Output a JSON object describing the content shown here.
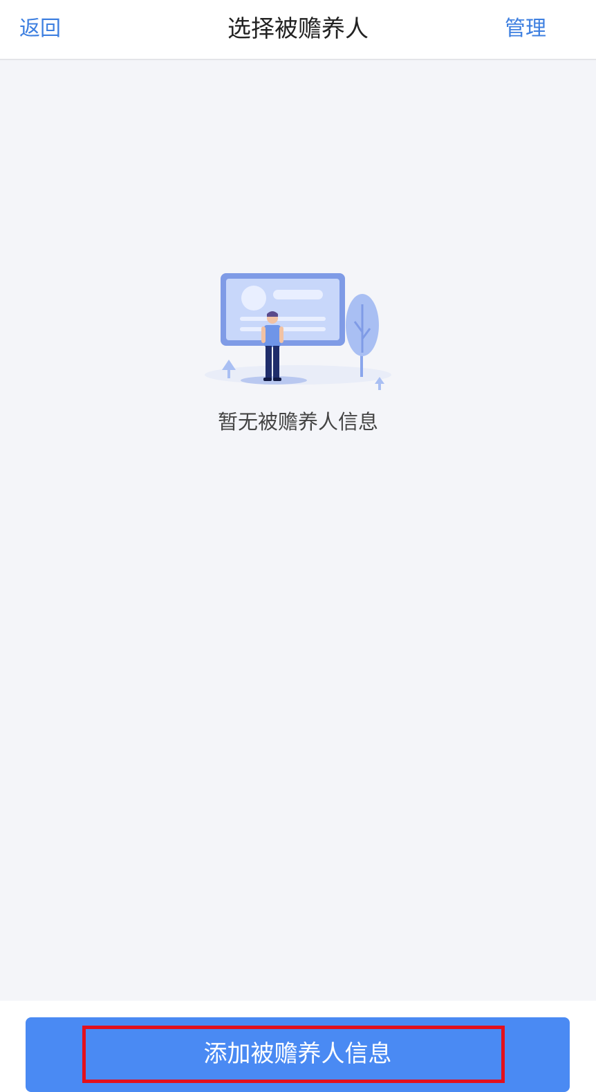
{
  "nav": {
    "back_label": "返回",
    "title": "选择被赡养人",
    "manage_label": "管理"
  },
  "empty_state": {
    "illustration_icon": "person-billboard-illustration-icon",
    "message": "暂无被赡养人信息"
  },
  "footer": {
    "add_button_label": "添加被赡养人信息"
  },
  "colors": {
    "accent": "#4a8af3",
    "link": "#3d7fe0",
    "background": "#f4f5f9",
    "highlight": "#e3101c"
  }
}
